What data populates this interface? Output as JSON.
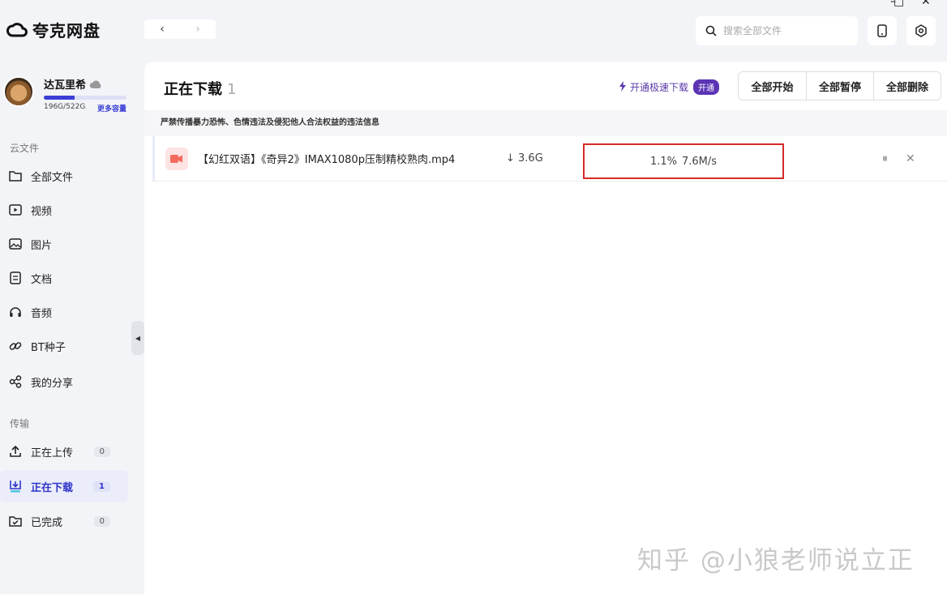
{
  "app": {
    "title": "夸克网盘"
  },
  "window_controls": {
    "minimize": "–",
    "maximize": "□",
    "close": "✕"
  },
  "search": {
    "placeholder": "搜索全部文件"
  },
  "user": {
    "name": "达瓦里希",
    "quota_text": "196G/522G",
    "quota_fraction": 0.375,
    "more_capacity": "更多容量"
  },
  "sidebar": {
    "cloud_section": "云文件",
    "cloud_items": [
      {
        "label": "全部文件",
        "icon": "folder-icon"
      },
      {
        "label": "视频",
        "icon": "video-icon"
      },
      {
        "label": "图片",
        "icon": "image-icon"
      },
      {
        "label": "文档",
        "icon": "document-icon"
      },
      {
        "label": "音频",
        "icon": "headphones-icon"
      },
      {
        "label": "BT种子",
        "icon": "link-icon"
      },
      {
        "label": "我的分享",
        "icon": "share-icon"
      }
    ],
    "transfer_section": "传输",
    "transfer_items": [
      {
        "label": "正在上传",
        "badge": "0",
        "icon": "upload-icon"
      },
      {
        "label": "正在下载",
        "badge": "1",
        "icon": "download-icon",
        "active": true
      },
      {
        "label": "已完成",
        "badge": "0",
        "icon": "completed-icon"
      }
    ]
  },
  "main": {
    "title": "正在下载",
    "count": "1",
    "speed_promo": "开通极速下载",
    "speed_pill": "开通",
    "buttons": {
      "start_all": "全部开始",
      "pause_all": "全部暂停",
      "delete_all": "全部删除"
    },
    "notice": "严禁传播暴力恐怖、色情违法及侵犯他人合法权益的违法信息",
    "downloads": [
      {
        "name": "【幻红双语】《奇异2》IMAX1080p压制精校熟肉.mp4",
        "size": "3.6G",
        "progress": "1.1%",
        "speed": "7.6M/s",
        "pause": "⏸",
        "cancel": "✕"
      }
    ]
  },
  "watermark": "知乎 @小狼老师说立正",
  "colors": {
    "accent": "#2f35c9",
    "highlight_border": "#d62a2a",
    "promo": "#5b34b4"
  }
}
